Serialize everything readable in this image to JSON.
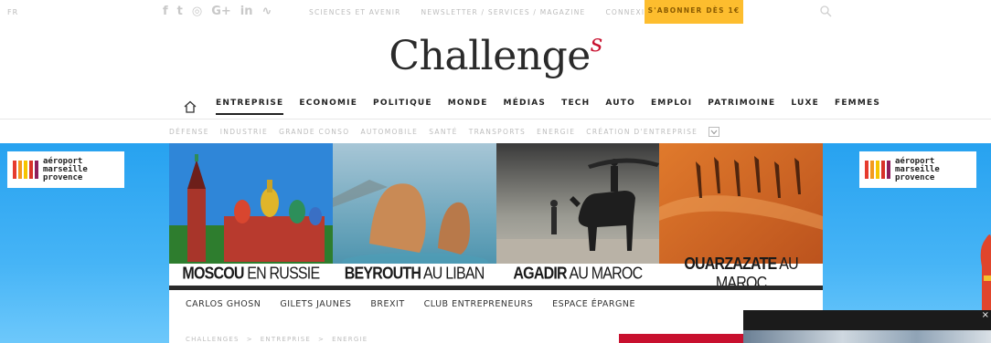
{
  "topbar": {
    "lang": "FR",
    "social_icons": [
      "facebook-icon",
      "twitter-icon",
      "instagram-icon",
      "googleplus-icon",
      "linkedin-icon",
      "rss-icon"
    ],
    "social_glyphs": [
      "f",
      "t",
      "◎",
      "G+",
      "in",
      "∿"
    ],
    "links": [
      "SCIENCES ET AVENIR",
      "NEWSLETTER / SERVICES / MAGAZINE",
      "CONNEXION"
    ],
    "subscribe": "S'ABONNER DÈS 1€",
    "accent": "#fdbd2e"
  },
  "logo": {
    "main": "Challenge",
    "suffix": "s",
    "accent": "#c8102e"
  },
  "mainnav": {
    "items": [
      "ENTREPRISE",
      "ECONOMIE",
      "POLITIQUE",
      "MONDE",
      "MÉDIAS",
      "TECH",
      "AUTO",
      "EMPLOI",
      "PATRIMOINE",
      "LUXE",
      "FEMMES"
    ],
    "active_index": 0
  },
  "subnav": {
    "items": [
      "DÉFENSE",
      "INDUSTRIE",
      "GRANDE CONSO",
      "AUTOMOBILE",
      "SANTÉ",
      "TRANSPORTS",
      "ENERGIE",
      "CRÉATION D'ENTREPRISE"
    ]
  },
  "ad": {
    "brand_lines": [
      "aéroport",
      "marseille",
      "provence"
    ],
    "brand_bar_colors": [
      "#e63b2e",
      "#f39a1e",
      "#f6c500",
      "#d9322a",
      "#8e1e5c"
    ],
    "panels": [
      {
        "bold": "MOSCOU",
        "rest": "EN RUSSIE"
      },
      {
        "bold": "BEYROUTH",
        "rest": "AU LIBAN"
      },
      {
        "bold": "AGADIR",
        "rest": "AU MAROC"
      },
      {
        "bold": "OUARZAZATE",
        "rest": "AU MAROC"
      }
    ]
  },
  "tags": [
    "CARLOS GHOSN",
    "GILETS JAUNES",
    "BREXIT",
    "CLUB ENTREPRENEURS",
    "ESPACE ÉPARGNE"
  ],
  "breadcrumb": [
    "CHALLENGES",
    ">",
    "ENTREPRISE",
    ">",
    "ENERGIE"
  ]
}
